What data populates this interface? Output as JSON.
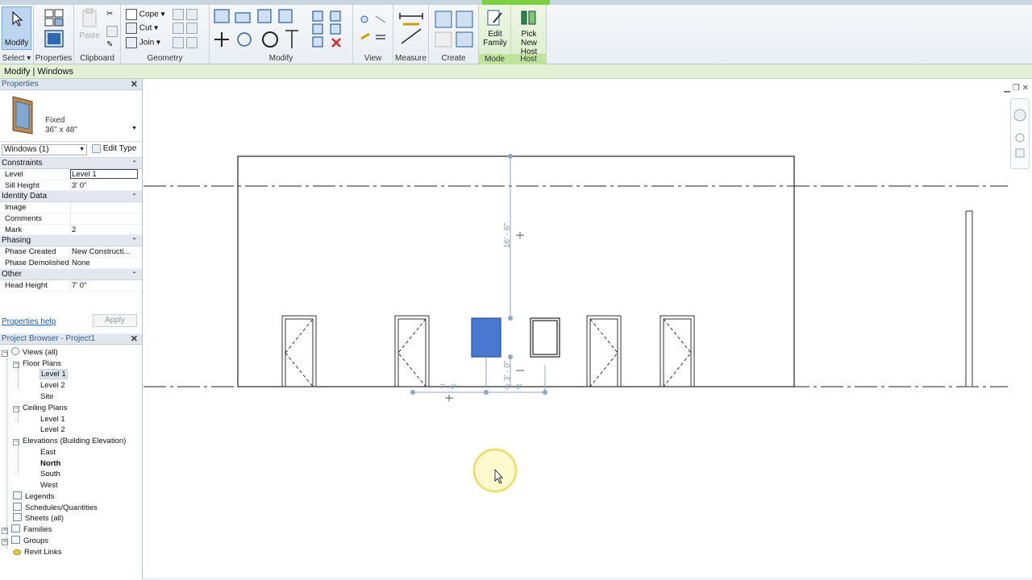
{
  "ribbon": {
    "panels": {
      "select": "Select",
      "properties": "Properties",
      "clipboard": "Clipboard",
      "geometry": "Geometry",
      "modify": "Modify",
      "view": "View",
      "measure": "Measure",
      "create": "Create",
      "mode": "Mode",
      "host": "Host"
    },
    "buttons": {
      "modify": "Modify",
      "paste": "Paste",
      "cope": "Cope",
      "cut": "Cut",
      "join": "Join",
      "edit_family": "Edit Family",
      "pick_new_host": "Pick New Host"
    },
    "accent_color": "#7ccf3f"
  },
  "options_bar": {
    "context": "Modify | Windows"
  },
  "properties": {
    "title": "Properties",
    "type_family": "Fixed",
    "type_name": "36\" x 48\"",
    "instance_filter": "Windows (1)",
    "edit_type": "Edit Type",
    "groups": {
      "constraints": "Constraints",
      "identity": "Identity Data",
      "phasing": "Phasing",
      "other": "Other"
    },
    "rows": {
      "level_k": "Level",
      "level_v": "Level 1",
      "sill_k": "Sill Height",
      "sill_v": "3'  0\"",
      "image_k": "Image",
      "image_v": "",
      "comments_k": "Comments",
      "comments_v": "",
      "mark_k": "Mark",
      "mark_v": "2",
      "phase_created_k": "Phase Created",
      "phase_created_v": "New Constructi...",
      "phase_demolished_k": "Phase Demolished",
      "phase_demolished_v": "None",
      "head_k": "Head Height",
      "head_v": "7'  0\""
    },
    "help": "Properties help",
    "apply": "Apply"
  },
  "browser": {
    "title": "Project Browser - Project1",
    "nodes": {
      "views": "Views (all)",
      "floor_plans": "Floor Plans",
      "fp_level1": "Level 1",
      "fp_level2": "Level 2",
      "fp_site": "Site",
      "ceiling_plans": "Ceiling Plans",
      "cp_level1": "Level 1",
      "cp_level2": "Level 2",
      "elevations": "Elevations (Building Elevation)",
      "el_east": "East",
      "el_north": "North",
      "el_south": "South",
      "el_west": "West",
      "legends": "Legends",
      "schedules": "Schedules/Quantities",
      "sheets": "Sheets (all)",
      "families": "Families",
      "groups": "Groups",
      "links": "Revit Links"
    }
  },
  "canvas": {
    "dim_height": "16' - 6\"",
    "dim_sill": "3' - 0\"",
    "dim_left": "7' - 6\"",
    "dim_right": "3' - 0\"",
    "selected_color": "#4a78d0"
  }
}
